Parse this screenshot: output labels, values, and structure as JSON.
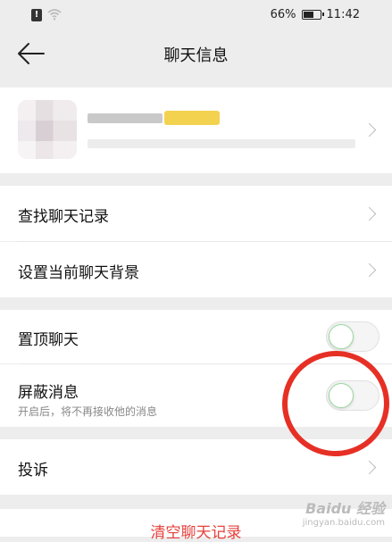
{
  "status": {
    "battery": "66%",
    "time": "11:42",
    "alert": "!",
    "battery_level": 0.66
  },
  "nav": {
    "title": "聊天信息"
  },
  "rows": {
    "find_history": "查找聊天记录",
    "set_background": "设置当前聊天背景",
    "pin_chat": "置顶聊天",
    "mute": "屏蔽消息",
    "mute_sub": "开启后，将不再接收他的消息",
    "report": "投诉"
  },
  "toggles": {
    "pin_chat": false,
    "mute": false
  },
  "danger": {
    "clear_history": "清空聊天记录"
  },
  "watermark": {
    "logo": "Baidu 经验",
    "url": "jingyan.baidu.com"
  },
  "colors": {
    "accent_red": "#e5403b",
    "annotation_circle": "#e63025",
    "toggle_knob_border": "#9bd9a0"
  }
}
